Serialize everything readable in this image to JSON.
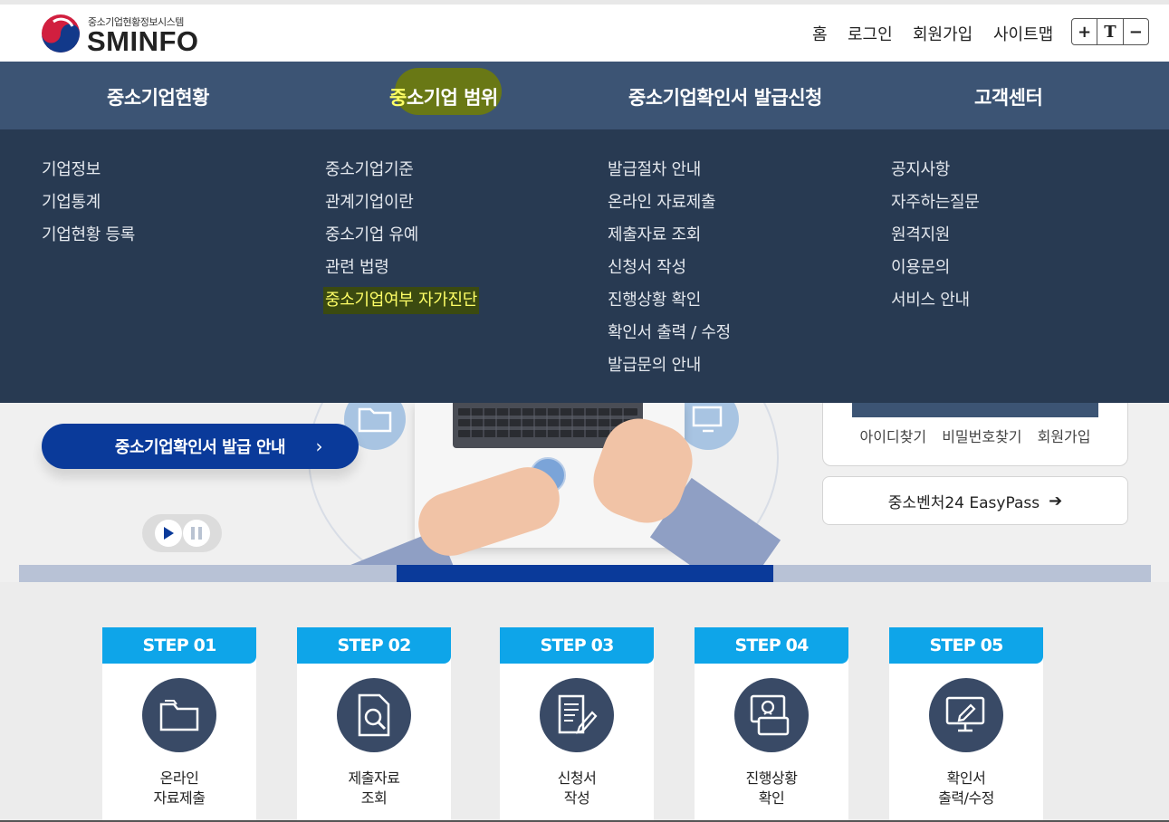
{
  "logo": {
    "sub": "중소기업현황정보시스템",
    "main": "SMINFO"
  },
  "util": {
    "home": "홈",
    "login": "로그인",
    "signup": "회원가입",
    "sitemap": "사이트맵",
    "font_plus": "+",
    "font_t": "T",
    "font_minus": "−"
  },
  "gnb": {
    "items": [
      "중소기업현황",
      "중소기업 범위",
      "중소기업확인서 발급신청",
      "고객센터"
    ]
  },
  "dropdown": {
    "col1": [
      "기업정보",
      "기업통계",
      "기업현황 등록"
    ],
    "col2": [
      "중소기업기준",
      "관계기업이란",
      "중소기업 유예",
      "관련 법령",
      "중소기업여부 자가진단"
    ],
    "col3": [
      "발급절차 안내",
      "온라인 자료제출",
      "제출자료 조회",
      "신청서 작성",
      "진행상황 확인",
      "확인서 출력 / 수정",
      "발급문의 안내"
    ],
    "col4": [
      "공지사항",
      "자주하는질문",
      "원격지원",
      "이용문의",
      "서비스 안내"
    ]
  },
  "hero": {
    "button": "중소기업확인서 발급 안내",
    "chevron": "›",
    "slide_progress": {
      "current": 2,
      "total": 3
    }
  },
  "login": {
    "find_id": "아이디찾기",
    "find_pw": "비밀번호찾기",
    "signup": "회원가입"
  },
  "easypass": {
    "label": "중소벤처24 EasyPass",
    "arrow": "➔"
  },
  "steps": [
    {
      "head": "STEP 01",
      "line1": "온라인",
      "line2": "자료제출",
      "icon": "folder-icon"
    },
    {
      "head": "STEP 02",
      "line1": "제출자료",
      "line2": "조회",
      "icon": "document-search-icon"
    },
    {
      "head": "STEP 03",
      "line1": "신청서",
      "line2": "작성",
      "icon": "document-edit-icon"
    },
    {
      "head": "STEP 04",
      "line1": "진행상황",
      "line2": "확인",
      "icon": "progress-monitor-icon"
    },
    {
      "head": "STEP 05",
      "line1": "확인서",
      "line2": "출력/수정",
      "icon": "monitor-print-icon"
    }
  ],
  "colors": {
    "nav": "#3c5474",
    "dropdown": "#283a52",
    "step_head": "#0ea5e9",
    "hero_button": "#0a3a9a",
    "highlight": "#ffff66"
  }
}
